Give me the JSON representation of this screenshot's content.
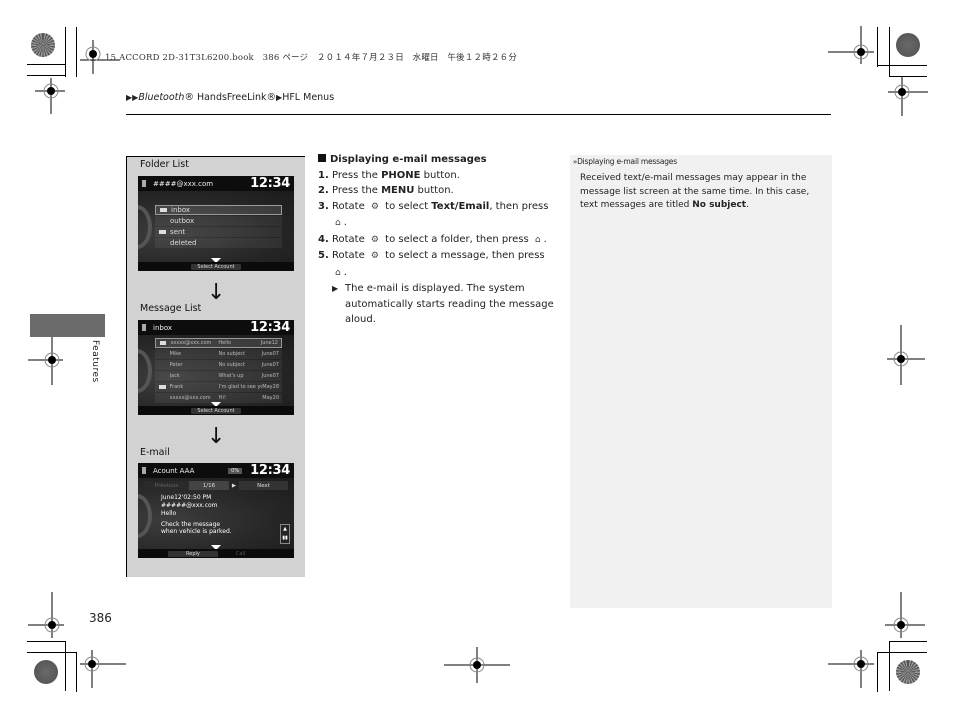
{
  "slug": "15 ACCORD 2D-31T3L6200.book　386 ページ　２０１４年７月２３日　水曜日　午後１２時２６分",
  "breadcrumb": {
    "marker": "▶▶",
    "part1_italic": "Bluetooth",
    "part1_reg": "® HandsFreeLink®",
    "sep": "▶",
    "part2": "HFL Menus"
  },
  "side_tab": {
    "label": "Features"
  },
  "page_number": "386",
  "left_panel": {
    "folder_list": {
      "label": "Folder List",
      "account": "####@xxx.com",
      "clock": "12:34",
      "folders": [
        {
          "name": "inbox",
          "icon": true,
          "selected": true
        },
        {
          "name": "outbox",
          "icon": false,
          "selected": false
        },
        {
          "name": "sent",
          "icon": true,
          "selected": false
        },
        {
          "name": "deleted",
          "icon": false,
          "selected": false
        }
      ],
      "footer_button": "Select Account"
    },
    "arrow": "↓",
    "message_list": {
      "label": "Message List",
      "folder": "inbox",
      "clock": "12:34",
      "messages": [
        {
          "from": "xxxxx@xxx.com",
          "subject": "Hello",
          "date": "June12",
          "icon": true,
          "selected": true
        },
        {
          "from": "Mike",
          "subject": "No subject",
          "date": "June07",
          "icon": false,
          "selected": false
        },
        {
          "from": "Peter",
          "subject": "No subject",
          "date": "June07",
          "icon": false,
          "selected": false
        },
        {
          "from": "Jack",
          "subject": "What's up",
          "date": "June07",
          "icon": false,
          "selected": false
        },
        {
          "from": "Frank",
          "subject": "I'm glad to see you",
          "date": "May28",
          "icon": true,
          "selected": false
        },
        {
          "from": "xxxxx@xxx.com",
          "subject": "Hi!",
          "date": "May20",
          "icon": false,
          "selected": false
        }
      ],
      "footer_button": "Select Account"
    },
    "email": {
      "label": "E-mail",
      "account": "Acount AAA",
      "status": "0%",
      "clock": "12:34",
      "tab_prev": "Previous",
      "tab_count": "1/16",
      "tab_next": "Next",
      "datetime": "June12'02:50 PM",
      "from": "#####@xxx.com",
      "subject": "Hello",
      "body_line1": "Check the message",
      "body_line2": "when vehicle is parked.",
      "footer_reply": "Reply",
      "footer_call": "Call"
    }
  },
  "instructions": {
    "heading": "Displaying e-mail messages",
    "steps": [
      {
        "num": "1.",
        "pre": "Press the ",
        "bold": "PHONE",
        "post": " button."
      },
      {
        "num": "2.",
        "pre": "Press the ",
        "bold": "MENU",
        "post": " button."
      },
      {
        "num": "3.",
        "pre": "Rotate ",
        "mid": " to select ",
        "bold": "Text/Email",
        "post": ", then press"
      },
      {
        "num": "4.",
        "pre": "Rotate ",
        "post": " to select a folder, then press "
      },
      {
        "num": "5.",
        "pre": "Rotate ",
        "post": " to select a message, then press"
      }
    ],
    "result": "The e-mail is displayed. The system automatically starts reading the message aloud.",
    "knob_icon": "⚙",
    "press_icon": "⌂"
  },
  "note": {
    "title": "Displaying e-mail messages",
    "text_pre": "Received text/e-mail messages may appear in the message list screen at the same time. In this case, text messages are titled ",
    "text_bold": "No subject",
    "text_post": "."
  }
}
